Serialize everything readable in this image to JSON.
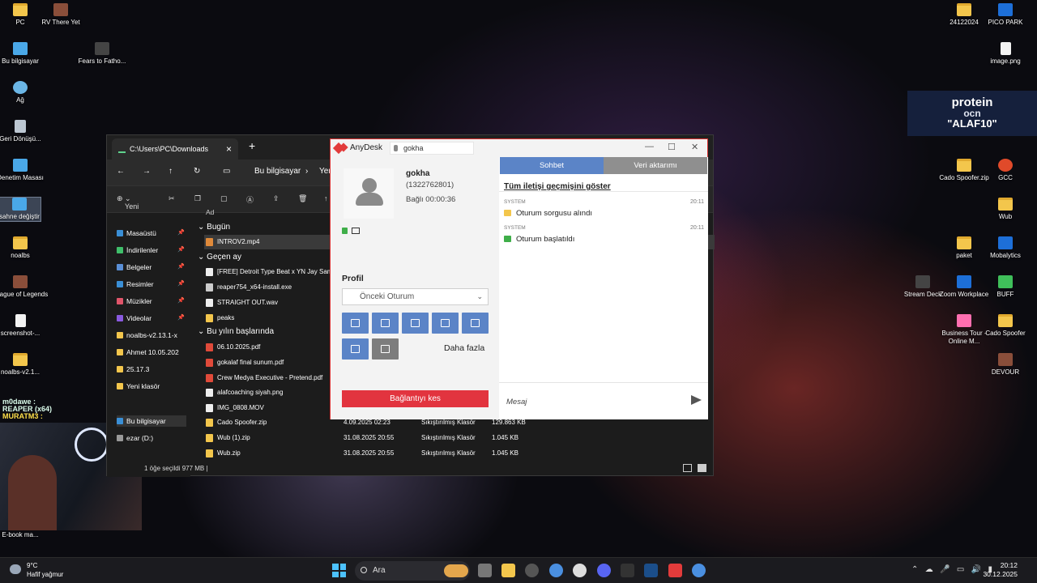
{
  "desktop": {
    "icons_left": [
      {
        "label": "PC",
        "icon": "folder"
      },
      {
        "label": "Bu bilgisayar",
        "icon": "pc"
      },
      {
        "label": "Ağ",
        "icon": "net"
      },
      {
        "label": "Geri Dönüşü...",
        "icon": "bin"
      },
      {
        "label": "Denetim Masası",
        "icon": "pc"
      },
      {
        "label": "sahne değiştir",
        "icon": "pc"
      },
      {
        "label": "noalbs",
        "icon": "folder"
      },
      {
        "label": "League of Legends",
        "icon": "game"
      },
      {
        "label": "screenshot-...",
        "icon": "file"
      },
      {
        "label": "noalbs-v2.1...",
        "icon": "folder"
      },
      {
        "label": "E-book ma...",
        "icon": "file"
      }
    ],
    "icons_col2": [
      {
        "label": "RV There Yet",
        "icon": "game"
      },
      {
        "label": "Fears to Fatho...",
        "icon": "dark"
      }
    ],
    "icons_right": [
      {
        "label": "24122024",
        "icon": "folder"
      },
      {
        "label": "PICO PARK",
        "icon": "blue"
      },
      {
        "label": "image.png",
        "icon": "file"
      },
      {
        "label": "Cado Spoofer.zip",
        "icon": "folder"
      },
      {
        "label": "GCC",
        "icon": "red"
      },
      {
        "label": "Wub",
        "icon": "folder"
      },
      {
        "label": "paket",
        "icon": "folder"
      },
      {
        "label": "Mobalytics",
        "icon": "blue"
      },
      {
        "label": "Stream Deck",
        "icon": "dark"
      },
      {
        "label": "Zoom Workplace",
        "icon": "blue"
      },
      {
        "label": "BUFF",
        "icon": "green"
      },
      {
        "label": "Business Tour - Online M...",
        "icon": "pink"
      },
      {
        "label": "Cado Spoofer",
        "icon": "folder"
      },
      {
        "label": "DEVOUR",
        "icon": "game"
      }
    ],
    "banner": {
      "line1": "protein",
      "line2": "ocn",
      "line3": "\"ALAF10\""
    },
    "overlay": {
      "user": "m0dawe :",
      "reaper": "REAPER (x64)",
      "murat": "MURATM3 :"
    }
  },
  "explorer": {
    "tab_title": "C:\\Users\\PC\\Downloads",
    "new_tab": "+",
    "breadcrumb": [
      "Bu bilgisayar",
      "Yer"
    ],
    "toolbar": {
      "new_label": "Yeni"
    },
    "nav": [
      {
        "label": "Masaüstü",
        "color": "#3a8fd6",
        "pinned": true
      },
      {
        "label": "İndirilenler",
        "color": "#3fbf6a",
        "pinned": true
      },
      {
        "label": "Belgeler",
        "color": "#5a8fd6",
        "pinned": true
      },
      {
        "label": "Resimler",
        "color": "#3a8fd6",
        "pinned": true
      },
      {
        "label": "Müzikler",
        "color": "#e0556a",
        "pinned": true
      },
      {
        "label": "Videolar",
        "color": "#8a5ae0",
        "pinned": true
      },
      {
        "label": "noalbs-v2.13.1-x",
        "color": "#f3c64c",
        "pinned": false
      },
      {
        "label": "Ahmet 10.05.202",
        "color": "#f3c64c",
        "pinned": false
      },
      {
        "label": "25.17.3",
        "color": "#f3c64c",
        "pinned": false
      },
      {
        "label": "Yeni klasör",
        "color": "#f3c64c",
        "pinned": false
      },
      {
        "label": "Bu bilgisayar",
        "color": "#3a8fd6",
        "pinned": false
      },
      {
        "label": "ezar (D:)",
        "color": "#999999",
        "pinned": false
      }
    ],
    "column_name": "Ad",
    "groups": {
      "today": "Bugün",
      "last_month": "Geçen ay",
      "this_year": "Bu yılın başlarında"
    },
    "files_today": [
      {
        "name": "INTROV2.mp4",
        "color": "#e08a3a"
      }
    ],
    "files_last_month": [
      {
        "name": "[FREE] Detroit Type Beat x YN Jay Sample",
        "color": "#eeeeee"
      },
      {
        "name": "reaper754_x64-install.exe",
        "color": "#cccccc"
      },
      {
        "name": "STRAIGHT OUT.wav",
        "color": "#eeeeee"
      },
      {
        "name": "peaks",
        "color": "#f3c64c"
      }
    ],
    "files_this_year": [
      {
        "name": "06.10.2025.pdf",
        "color": "#e04a3a"
      },
      {
        "name": "gokalaf final sunum.pdf",
        "color": "#e04a3a"
      },
      {
        "name": "Crew Medya Executive - Pretend.pdf",
        "color": "#e04a3a"
      },
      {
        "name": "alafcoaching siyah.png",
        "color": "#eeeeee"
      },
      {
        "name": "IMG_0808.MOV",
        "color": "#eeeeee"
      },
      {
        "name": "Cado Spoofer.zip",
        "color": "#f3c64c",
        "date": "4.09.2025 02:23",
        "type": "Sıkıştırılmış Klasör",
        "size": "129.863 KB"
      },
      {
        "name": "Wub (1).zip",
        "color": "#f3c64c",
        "date": "31.08.2025 20:55",
        "type": "Sıkıştırılmış Klasör",
        "size": "1.045 KB"
      },
      {
        "name": "Wub.zip",
        "color": "#f3c64c",
        "date": "31.08.2025 20:55",
        "type": "Sıkıştırılmış Klasör",
        "size": "1.045 KB"
      }
    ],
    "status": "1 öğe seçildi  977 MB  |"
  },
  "anydesk": {
    "app_name": "AnyDesk",
    "address_value": "gokha",
    "user": {
      "name": "gokha",
      "id": "(1322762801)",
      "connected": "Bağlı 00:00:36"
    },
    "profile_label": "Profil",
    "profile_select": "Önceki Oturum",
    "more_label": "Daha fazla",
    "disconnect_label": "Bağlantıyı kes",
    "tabs": {
      "chat": "Sohbet",
      "transfer": "Veri aktarımı"
    },
    "history_link": "Tüm iletişi geçmişini göster",
    "messages": [
      {
        "sender": "SYSTEM",
        "time": "20:11",
        "text": "Oturum sorgusu alındı",
        "color": "#f3c64c"
      },
      {
        "sender": "SYSTEM",
        "time": "20:11",
        "text": "Oturum başlatıldı",
        "color": "#3fae49"
      }
    ],
    "message_placeholder": "Mesaj"
  },
  "taskbar": {
    "weather_temp": "9°C",
    "weather_desc": "Hafif yağmur",
    "search_label": "Ara",
    "time": "20:12",
    "date": "30.12.2025",
    "tray_icons": [
      "chevron-up-icon",
      "cloud-icon",
      "mic-icon",
      "display-icon",
      "volume-icon",
      "battery-icon"
    ]
  }
}
